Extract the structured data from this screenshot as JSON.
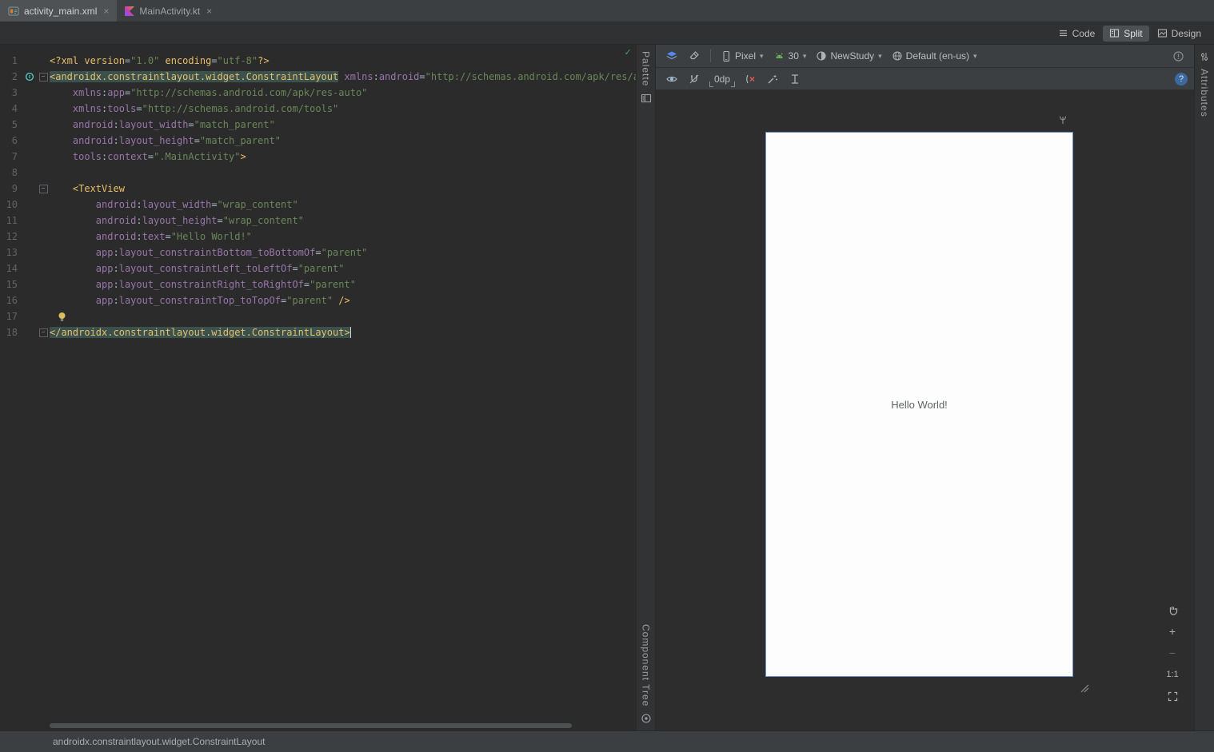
{
  "colors": {
    "editor_bg": "#2b2b2b",
    "panel_bg": "#3c3f41",
    "tag": "#e8bf6a",
    "attribute": "#9876aa",
    "string": "#6a8759",
    "tag_match_highlight": "#3b514d",
    "android_green": "#6fba5c",
    "accent_blue": "#548af7",
    "phone_border": "#6a93c8",
    "check_green": "#499c54"
  },
  "icons": {
    "chevron_down": "▾",
    "close": "×",
    "check": "✓",
    "help": "?",
    "zoom_in": "+",
    "zoom_out": "−",
    "antenna": "ψ"
  },
  "tab_bar": {
    "tabs": [
      {
        "label": "activity_main.xml"
      },
      {
        "label": "MainActivity.kt"
      }
    ]
  },
  "editor_header": {
    "modes": [
      {
        "label": "Code"
      },
      {
        "label": "Split"
      },
      {
        "label": "Design"
      }
    ]
  },
  "stripes": {
    "palette": "Palette",
    "component_tree": "Component Tree",
    "attributes": "Attributes"
  },
  "editor": {
    "fold_lines": [
      2,
      9,
      18
    ],
    "bulb_line": 17,
    "gutter_icon_line": 2,
    "lines": [
      [
        [
          "t",
          "<?xml version"
        ],
        [
          "p",
          "="
        ],
        [
          "s",
          "\"1.0\""
        ],
        [
          "t",
          " encoding"
        ],
        [
          "p",
          "="
        ],
        [
          "s",
          "\"utf-8\""
        ],
        [
          "t",
          "?>"
        ]
      ],
      [
        [
          "thl",
          "<androidx.constraintlayout.widget.ConstraintLayout"
        ],
        [
          "p",
          " "
        ],
        [
          "a",
          "xmlns"
        ],
        [
          "p",
          ":"
        ],
        [
          "a",
          "android"
        ],
        [
          "p",
          "="
        ],
        [
          "s",
          "\"http://schemas.android.com/apk/res/android\""
        ]
      ],
      [
        [
          "p",
          "    "
        ],
        [
          "a",
          "xmlns"
        ],
        [
          "p",
          ":"
        ],
        [
          "a",
          "app"
        ],
        [
          "p",
          "="
        ],
        [
          "s",
          "\"http://schemas.android.com/apk/res-auto\""
        ]
      ],
      [
        [
          "p",
          "    "
        ],
        [
          "a",
          "xmlns"
        ],
        [
          "p",
          ":"
        ],
        [
          "a",
          "tools"
        ],
        [
          "p",
          "="
        ],
        [
          "s",
          "\"http://schemas.android.com/tools\""
        ]
      ],
      [
        [
          "p",
          "    "
        ],
        [
          "a",
          "android"
        ],
        [
          "p",
          ":"
        ],
        [
          "a",
          "layout_width"
        ],
        [
          "p",
          "="
        ],
        [
          "s",
          "\"match_parent\""
        ]
      ],
      [
        [
          "p",
          "    "
        ],
        [
          "a",
          "android"
        ],
        [
          "p",
          ":"
        ],
        [
          "a",
          "layout_height"
        ],
        [
          "p",
          "="
        ],
        [
          "s",
          "\"match_parent\""
        ]
      ],
      [
        [
          "p",
          "    "
        ],
        [
          "a",
          "tools"
        ],
        [
          "p",
          ":"
        ],
        [
          "a",
          "context"
        ],
        [
          "p",
          "="
        ],
        [
          "s",
          "\".MainActivity\""
        ],
        [
          "t",
          ">"
        ]
      ],
      [],
      [
        [
          "p",
          "    "
        ],
        [
          "t",
          "<TextView"
        ]
      ],
      [
        [
          "p",
          "        "
        ],
        [
          "a",
          "android"
        ],
        [
          "p",
          ":"
        ],
        [
          "a",
          "layout_width"
        ],
        [
          "p",
          "="
        ],
        [
          "s",
          "\"wrap_content\""
        ]
      ],
      [
        [
          "p",
          "        "
        ],
        [
          "a",
          "android"
        ],
        [
          "p",
          ":"
        ],
        [
          "a",
          "layout_height"
        ],
        [
          "p",
          "="
        ],
        [
          "s",
          "\"wrap_content\""
        ]
      ],
      [
        [
          "p",
          "        "
        ],
        [
          "a",
          "android"
        ],
        [
          "p",
          ":"
        ],
        [
          "a",
          "text"
        ],
        [
          "p",
          "="
        ],
        [
          "s",
          "\"Hello World!\""
        ]
      ],
      [
        [
          "p",
          "        "
        ],
        [
          "a",
          "app"
        ],
        [
          "p",
          ":"
        ],
        [
          "a",
          "layout_constraintBottom_toBottomOf"
        ],
        [
          "p",
          "="
        ],
        [
          "s",
          "\"parent\""
        ]
      ],
      [
        [
          "p",
          "        "
        ],
        [
          "a",
          "app"
        ],
        [
          "p",
          ":"
        ],
        [
          "a",
          "layout_constraintLeft_toLeftOf"
        ],
        [
          "p",
          "="
        ],
        [
          "s",
          "\"parent\""
        ]
      ],
      [
        [
          "p",
          "        "
        ],
        [
          "a",
          "app"
        ],
        [
          "p",
          ":"
        ],
        [
          "a",
          "layout_constraintRight_toRightOf"
        ],
        [
          "p",
          "="
        ],
        [
          "s",
          "\"parent\""
        ]
      ],
      [
        [
          "p",
          "        "
        ],
        [
          "a",
          "app"
        ],
        [
          "p",
          ":"
        ],
        [
          "a",
          "layout_constraintTop_toTopOf"
        ],
        [
          "p",
          "="
        ],
        [
          "s",
          "\"parent\""
        ],
        [
          "t",
          " />"
        ]
      ],
      [],
      [
        [
          "thl",
          "</androidx.constraintlayout.widget.ConstraintLayout>"
        ],
        [
          "caret",
          ""
        ]
      ]
    ]
  },
  "design": {
    "toolbar": {
      "device": "Pixel",
      "api": "30",
      "theme": "NewStudy",
      "locale": "Default (en-us)",
      "margin": "0dp"
    },
    "preview": {
      "text": "Hello World!"
    },
    "zoom": {
      "ratio": "1:1"
    }
  },
  "status_bar": {
    "text": "androidx.constraintlayout.widget.ConstraintLayout"
  }
}
